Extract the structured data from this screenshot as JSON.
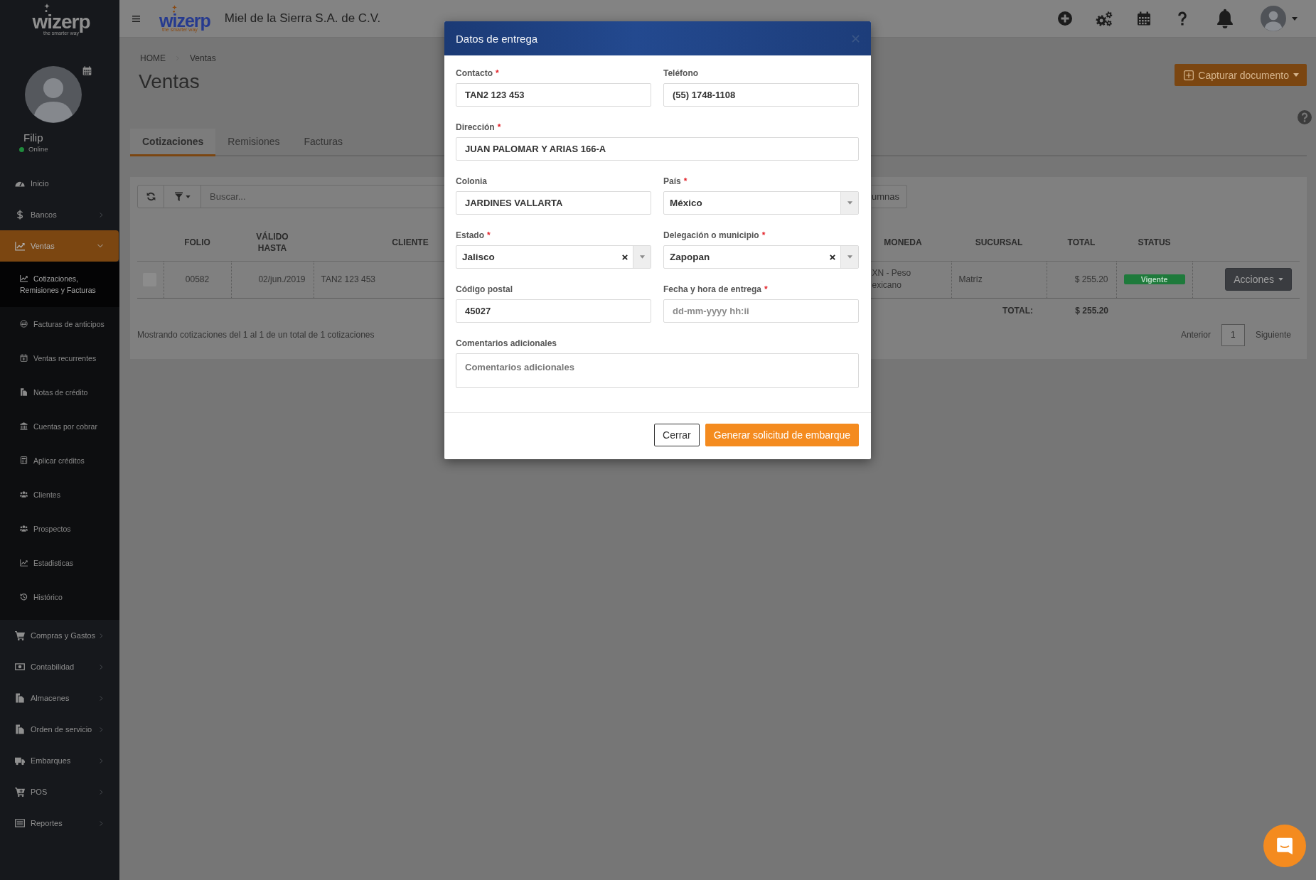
{
  "sidebar": {
    "logo": {
      "wordmark": "wizerp",
      "tagline": "the smarter way"
    },
    "user": {
      "name": "Filip",
      "status": "Online",
      "online": true
    },
    "menu": [
      {
        "label": "Inicio",
        "kind": "link",
        "selected": false
      },
      {
        "label": "Bancos",
        "kind": "menu",
        "selected": false,
        "expanded": false
      },
      {
        "label": "Ventas",
        "kind": "menu",
        "selected": true,
        "expanded": true,
        "children": [
          {
            "label": "Cotizaciones, Remisiones y Facturas",
            "selected": true
          },
          {
            "label": "Facturas de anticipos",
            "selected": false
          },
          {
            "label": "Ventas recurrentes",
            "selected": false
          },
          {
            "label": "Notas de crédito",
            "selected": false
          },
          {
            "label": "Cuentas por cobrar",
            "selected": false
          },
          {
            "label": "Aplicar créditos",
            "selected": false
          },
          {
            "label": "Clientes",
            "selected": false
          },
          {
            "label": "Prospectos",
            "selected": false
          },
          {
            "label": "Estadisticas",
            "selected": false
          },
          {
            "label": "Histórico",
            "selected": false
          }
        ]
      },
      {
        "label": "Compras y Gastos",
        "kind": "menu",
        "selected": false,
        "expanded": false
      },
      {
        "label": "Contabilidad",
        "kind": "menu",
        "selected": false,
        "expanded": false
      },
      {
        "label": "Almacenes",
        "kind": "menu",
        "selected": false,
        "expanded": false
      },
      {
        "label": "Orden de servicio",
        "kind": "menu",
        "selected": false,
        "expanded": false
      },
      {
        "label": "Embarques",
        "kind": "menu",
        "selected": false,
        "expanded": false
      },
      {
        "label": "POS",
        "kind": "menu",
        "selected": false,
        "expanded": false
      },
      {
        "label": "Reportes",
        "kind": "menu",
        "selected": false,
        "expanded": false
      }
    ]
  },
  "topbar": {
    "logo": {
      "wordmark": "wizerp",
      "tagline": "the smarter way"
    },
    "company": "Miel de la Sierra S.A. de C.V."
  },
  "page": {
    "breadcrumb": [
      "HOME",
      "Ventas"
    ],
    "title": "Ventas",
    "action_button": "Capturar documento",
    "tabs": [
      {
        "label": "Cotizaciones",
        "selected": true
      },
      {
        "label": "Remisiones",
        "selected": false
      },
      {
        "label": "Facturas",
        "selected": false
      }
    ]
  },
  "table": {
    "search": {
      "placeholder": "Buscar..."
    },
    "columns_button": "umnas",
    "columns": [
      "FOLIO",
      "VÁLIDO HASTA",
      "CLIENTE",
      "MONEDA",
      "SUCURSAL",
      "TOTAL",
      "STATUS"
    ],
    "rows": [
      {
        "checked": false,
        "cells": [
          "00582",
          "02/jun./2019",
          "TAN2 123 453",
          "XN - Peso exicano",
          "Matríz",
          "$ 255.20"
        ],
        "status": "Vigente",
        "action": "Acciones"
      }
    ],
    "total_label": "TOTAL:",
    "total_value": "$ 255.20",
    "summary": "Mostrando cotizaciones del 1 al 1 de un total de 1 cotizaciones",
    "pagination": {
      "previous": "Anterior",
      "pages": [
        {
          "label": "1",
          "selected": true
        }
      ],
      "next": "Siguiente"
    }
  },
  "modal": {
    "title": "Datos de entrega",
    "rows": [
      [
        {
          "label": "Contacto",
          "required_mark": "*",
          "kind": "text",
          "value": "TAN2 123 453"
        },
        {
          "label": "Teléfono",
          "kind": "text",
          "value": "(55) 1748-1108"
        }
      ],
      [
        {
          "label": "Dirección",
          "required_mark": "*",
          "kind": "text",
          "value": "JUAN PALOMAR Y ARIAS 166-A"
        }
      ],
      [
        {
          "label": "Colonia",
          "kind": "text",
          "value": "JARDINES VALLARTA"
        },
        {
          "label": "País",
          "required_mark": "*",
          "kind": "select",
          "value": "México",
          "clearable": false
        }
      ],
      [
        {
          "label": "Estado",
          "required_mark": "*",
          "kind": "select",
          "value": "Jalisco",
          "clearable": true
        },
        {
          "label": "Delegación o municipio",
          "required_mark": "*",
          "kind": "select",
          "value": "Zapopan",
          "clearable": true
        }
      ],
      [
        {
          "label": "Código postal",
          "kind": "text",
          "value": "45027"
        },
        {
          "label": "Fecha y hora de entrega",
          "required_mark": "*",
          "kind": "text",
          "placeholder": "dd-mm-yyyy hh:ii"
        }
      ],
      [
        {
          "label": "Comentarios adicionales",
          "kind": "textarea",
          "placeholder": "Comentarios adicionales"
        }
      ]
    ],
    "buttons": [
      {
        "label": "Cerrar",
        "kind": "secondary"
      },
      {
        "label": "Generar solicitud de embarque",
        "kind": "primary"
      }
    ]
  }
}
